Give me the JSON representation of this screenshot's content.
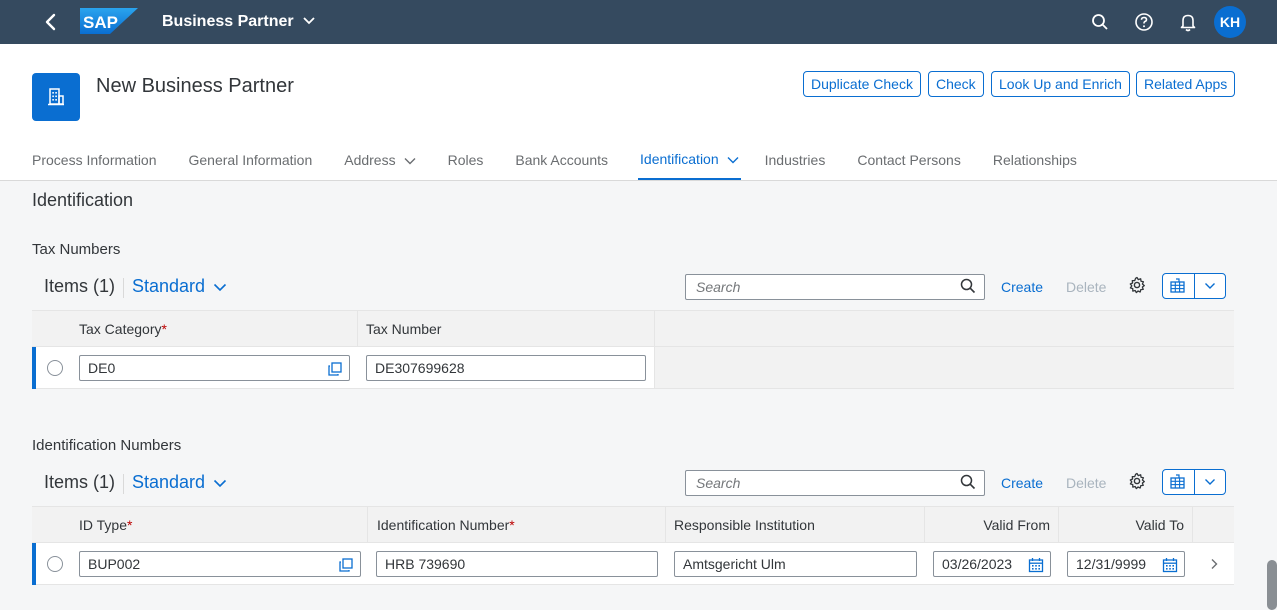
{
  "shell": {
    "brand": "SAP",
    "app_title": "Business Partner",
    "user_initials": "KH"
  },
  "header": {
    "title": "New Business Partner",
    "buttons": {
      "duplicate_check": "Duplicate Check",
      "check": "Check",
      "look_up": "Look Up and Enrich",
      "related_apps": "Related Apps"
    },
    "tabs": [
      {
        "label": "Process Information"
      },
      {
        "label": "General Information"
      },
      {
        "label": "Address"
      },
      {
        "label": "Roles"
      },
      {
        "label": "Bank Accounts"
      },
      {
        "label": "Identification"
      },
      {
        "label": "Industries"
      },
      {
        "label": "Contact Persons"
      },
      {
        "label": "Relationships"
      }
    ]
  },
  "section_title": "Identification",
  "tax_numbers": {
    "title": "Tax Numbers",
    "items_label": "Items (1)",
    "variant": "Standard",
    "search_placeholder": "Search",
    "create_label": "Create",
    "delete_label": "Delete",
    "columns": {
      "tax_category": "Tax Category",
      "tax_number": "Tax Number"
    },
    "rows": [
      {
        "tax_category": "DE0",
        "tax_number": "DE307699628"
      }
    ]
  },
  "identification_numbers": {
    "title": "Identification Numbers",
    "items_label": "Items (1)",
    "variant": "Standard",
    "search_placeholder": "Search",
    "create_label": "Create",
    "delete_label": "Delete",
    "columns": {
      "id_type": "ID Type",
      "identification_number": "Identification Number",
      "responsible_institution": "Responsible Institution",
      "valid_from": "Valid From",
      "valid_to": "Valid To"
    },
    "rows": [
      {
        "id_type": "BUP002",
        "identification_number": "HRB 739690",
        "responsible_institution": "Amtsgericht Ulm",
        "valid_from": "03/26/2023",
        "valid_to": "12/31/9999"
      }
    ]
  },
  "colors": {
    "shell": "#354a5f",
    "accent": "#0a6ed1",
    "required": "#bb0000"
  }
}
